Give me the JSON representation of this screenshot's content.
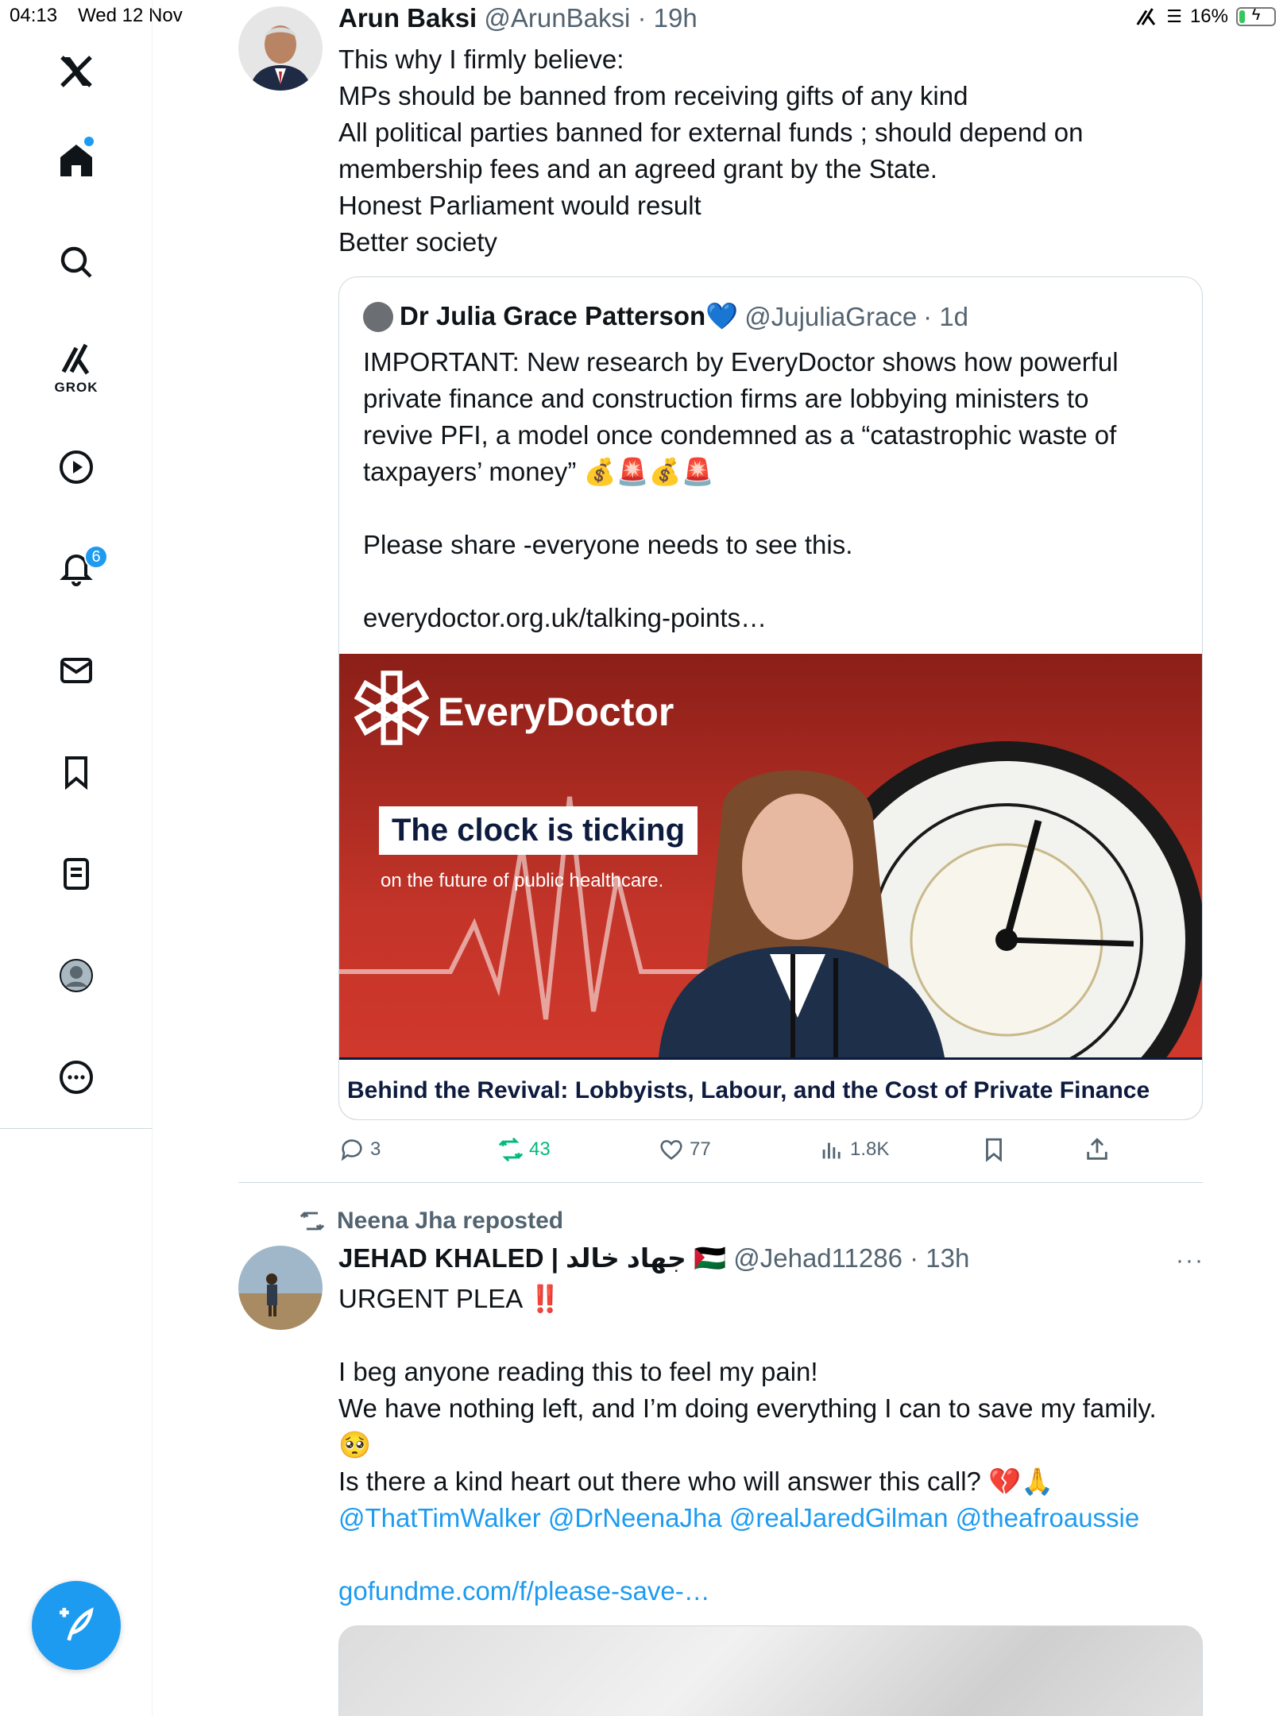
{
  "status": {
    "time": "04:13",
    "date": "Wed 12 Nov",
    "battery": "16%",
    "battery_level": 0.16
  },
  "sidebar": {
    "grok_label": "GROK",
    "notification_count": "6",
    "items": [
      "x-logo",
      "home",
      "search",
      "grok",
      "video",
      "notifications",
      "messages",
      "bookmarks",
      "lists",
      "profile",
      "more"
    ]
  },
  "tweet1": {
    "display_name": "Arun Baksi",
    "handle": "@ArunBaksi",
    "time": "· 19h",
    "lines": [
      "This why I firmly believe:",
      "MPs should be banned from receiving gifts of any kind",
      "All political parties banned for external funds ; should depend on",
      "membership fees and an agreed grant by the State.",
      "Honest Parliament would result",
      "Better society"
    ],
    "quote": {
      "display_name": "Dr Julia Grace Patterson💙",
      "handle": "@JujuliaGrace",
      "time": "· 1d",
      "lines": [
        "IMPORTANT: New research by EveryDoctor shows how powerful",
        "private finance and construction firms are lobbying ministers to",
        "revive PFI, a model once condemned as a “catastrophic waste of",
        "taxpayers’ money” 💰🚨💰🚨",
        "",
        "Please share -everyone needs to see this.",
        "",
        "everydoctor.org.uk/talking-points…"
      ],
      "image": {
        "brand": "EveryDoctor",
        "headline": "The clock is ticking",
        "subline": "on the future of public healthcare.",
        "caption": "Behind the Revival: Lobbyists, Labour, and the Cost of Private Finance"
      }
    },
    "actions": {
      "replies": "3",
      "reposts": "43",
      "likes": "77",
      "views": "1.8K"
    }
  },
  "tweet2": {
    "reposted_by": "Neena Jha reposted",
    "display_name": "JEHAD KHALED | جهاد خالد 🇵🇸",
    "handle": "@Jehad11286",
    "time": "· 13h",
    "more": "···",
    "lines": [
      "URGENT PLEA ‼️",
      "",
      "I beg anyone reading this to feel my pain!",
      "We have nothing left, and I’m doing everything I can to save my family.",
      "🥺",
      "Is there a kind heart out there who will answer this call? 💔🙏"
    ],
    "mentions": "@ThatTimWalker @DrNeenaJha @realJaredGilman @theafroaussie",
    "link": "gofundme.com/f/please-save-…"
  }
}
